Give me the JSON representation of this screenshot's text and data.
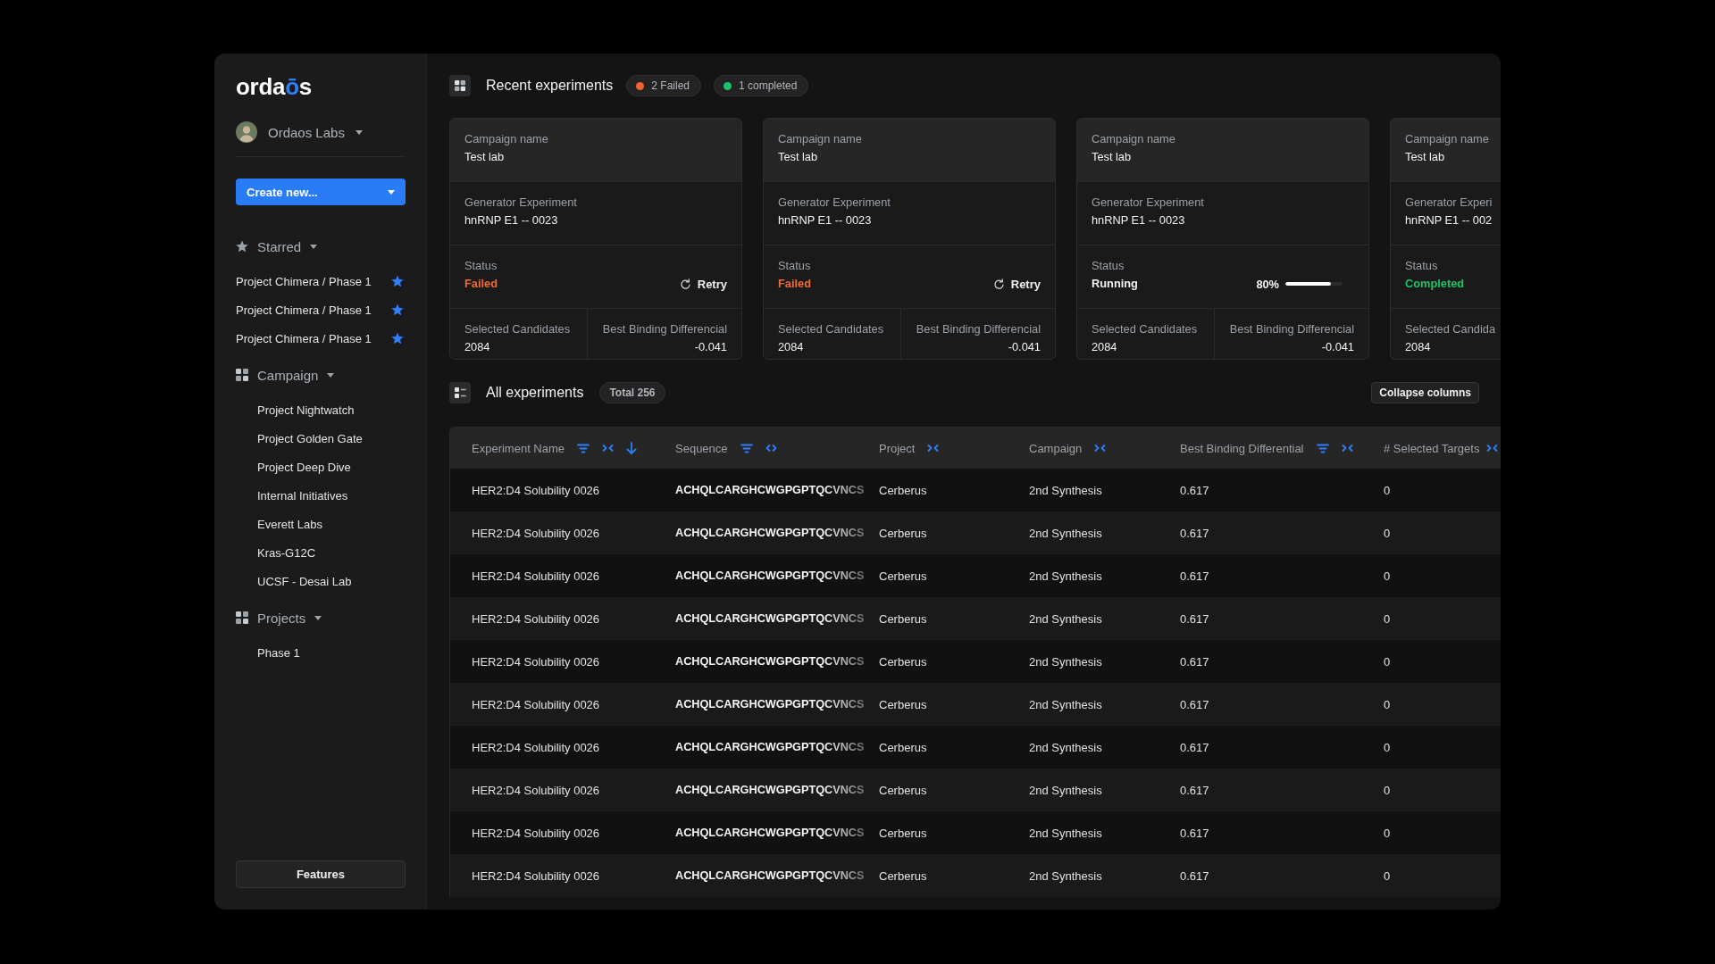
{
  "sidebar": {
    "logo": [
      {
        "text": "orda",
        "accent": false
      },
      {
        "text": "ō",
        "accent": true
      },
      {
        "text": "s",
        "accent": false
      }
    ],
    "org": {
      "name": "Ordaos Labs"
    },
    "create_button": {
      "label": "Create new..."
    },
    "sections": [
      {
        "kind": "starred",
        "title": "Starred",
        "expanded": true,
        "items": [
          {
            "label": "Project Chimera / Phase 1",
            "starred": true
          },
          {
            "label": "Project Chimera / Phase 1",
            "starred": true
          },
          {
            "label": "Project Chimera / Phase 1",
            "starred": true
          }
        ]
      },
      {
        "kind": "group",
        "title": "Campaign",
        "expanded": true,
        "items": [
          {
            "label": "Project Nightwatch"
          },
          {
            "label": "Project Golden Gate"
          },
          {
            "label": "Project Deep Dive"
          },
          {
            "label": "Internal Initiatives"
          },
          {
            "label": "Everett Labs"
          },
          {
            "label": "Kras-G12C"
          },
          {
            "label": "UCSF - Desai Lab"
          }
        ]
      },
      {
        "kind": "group",
        "title": "Projects",
        "expanded": true,
        "items": [
          {
            "label": "Phase 1"
          }
        ]
      }
    ],
    "footer_button": {
      "label": "Features"
    }
  },
  "recent": {
    "title": "Recent experiments",
    "badges": [
      {
        "label": "2 Failed",
        "color": "#f2622e"
      },
      {
        "label": "1 completed",
        "color": "#1fc16b"
      }
    ],
    "cards": [
      {
        "campaign_label": "Campaign name",
        "campaign": "Test lab",
        "generator_label": "Generator Experiment",
        "generator": "hnRNP E1 -- 0023",
        "status_label": "Status",
        "status": {
          "text": "Failed",
          "kind": "failed",
          "action": "Retry"
        },
        "candidates_label": "Selected Candidates",
        "candidates": "2084",
        "binding_label": "Best Binding Differencial",
        "binding": "-0.041"
      },
      {
        "campaign_label": "Campaign name",
        "campaign": "Test lab",
        "generator_label": "Generator Experiment",
        "generator": "hnRNP E1 -- 0023",
        "status_label": "Status",
        "status": {
          "text": "Failed",
          "kind": "failed",
          "action": "Retry"
        },
        "candidates_label": "Selected Candidates",
        "candidates": "2084",
        "binding_label": "Best Binding Differencial",
        "binding": "-0.041"
      },
      {
        "campaign_label": "Campaign name",
        "campaign": "Test lab",
        "generator_label": "Generator Experiment",
        "generator": "hnRNP E1 -- 0023",
        "status_label": "Status",
        "status": {
          "text": "Running",
          "kind": "running",
          "reading": "80%",
          "level": 0.8
        },
        "candidates_label": "Selected Candidates",
        "candidates": "2084",
        "binding_label": "Best Binding Differencial",
        "binding": "-0.041"
      },
      {
        "campaign_label": "Campaign name",
        "campaign": "Test lab",
        "generator_label": "Generator Experi",
        "generator": "hnRNP E1 -- 002",
        "status_label": "Status",
        "status": {
          "text": "Completed",
          "kind": "completed"
        },
        "candidates_label": "Selected Candida",
        "candidates": "2084"
      }
    ]
  },
  "all": {
    "title": "All experiments",
    "badge": "Total 256",
    "collapse_button": "Collapse columns",
    "table": {
      "columns": [
        {
          "label": "Experiment Name",
          "kind": "text",
          "filter": true,
          "collapsed": false,
          "sorted": true
        },
        {
          "label": "Sequence",
          "kind": "sequence",
          "filter": true,
          "collapsed": true,
          "sorted": false
        },
        {
          "label": "Project",
          "kind": "text",
          "filter": false,
          "collapsed": false,
          "sorted": false
        },
        {
          "label": "Campaign",
          "kind": "text",
          "filter": false,
          "collapsed": false,
          "sorted": false
        },
        {
          "label": "Best Binding Differential",
          "kind": "text",
          "filter": true,
          "collapsed": false,
          "sorted": false
        },
        {
          "label": "# Selected Targets",
          "kind": "text",
          "filter": false,
          "collapsed": false,
          "sorted": false
        }
      ],
      "rows": [
        [
          "HER2:D4 Solubility 0026",
          "ACHQLCARGHCWGPGPTQCVNCS",
          "Cerberus",
          "2nd Synthesis",
          "0.617",
          "0"
        ],
        [
          "HER2:D4 Solubility 0026",
          "ACHQLCARGHCWGPGPTQCVNCS",
          "Cerberus",
          "2nd Synthesis",
          "0.617",
          "0"
        ],
        [
          "HER2:D4 Solubility 0026",
          "ACHQLCARGHCWGPGPTQCVNCS",
          "Cerberus",
          "2nd Synthesis",
          "0.617",
          "0"
        ],
        [
          "HER2:D4 Solubility 0026",
          "ACHQLCARGHCWGPGPTQCVNCS",
          "Cerberus",
          "2nd Synthesis",
          "0.617",
          "0"
        ],
        [
          "HER2:D4 Solubility 0026",
          "ACHQLCARGHCWGPGPTQCVNCS",
          "Cerberus",
          "2nd Synthesis",
          "0.617",
          "0"
        ],
        [
          "HER2:D4 Solubility 0026",
          "ACHQLCARGHCWGPGPTQCVNCS",
          "Cerberus",
          "2nd Synthesis",
          "0.617",
          "0"
        ],
        [
          "HER2:D4 Solubility 0026",
          "ACHQLCARGHCWGPGPTQCVNCS",
          "Cerberus",
          "2nd Synthesis",
          "0.617",
          "0"
        ],
        [
          "HER2:D4 Solubility 0026",
          "ACHQLCARGHCWGPGPTQCVNCS",
          "Cerberus",
          "2nd Synthesis",
          "0.617",
          "0"
        ],
        [
          "HER2:D4 Solubility 0026",
          "ACHQLCARGHCWGPGPTQCVNCS",
          "Cerberus",
          "2nd Synthesis",
          "0.617",
          "0"
        ],
        [
          "HER2:D4 Solubility 0026",
          "ACHQLCARGHCWGPGPTQCVNCS",
          "Cerberus",
          "2nd Synthesis",
          "0.617",
          "0"
        ]
      ]
    }
  }
}
